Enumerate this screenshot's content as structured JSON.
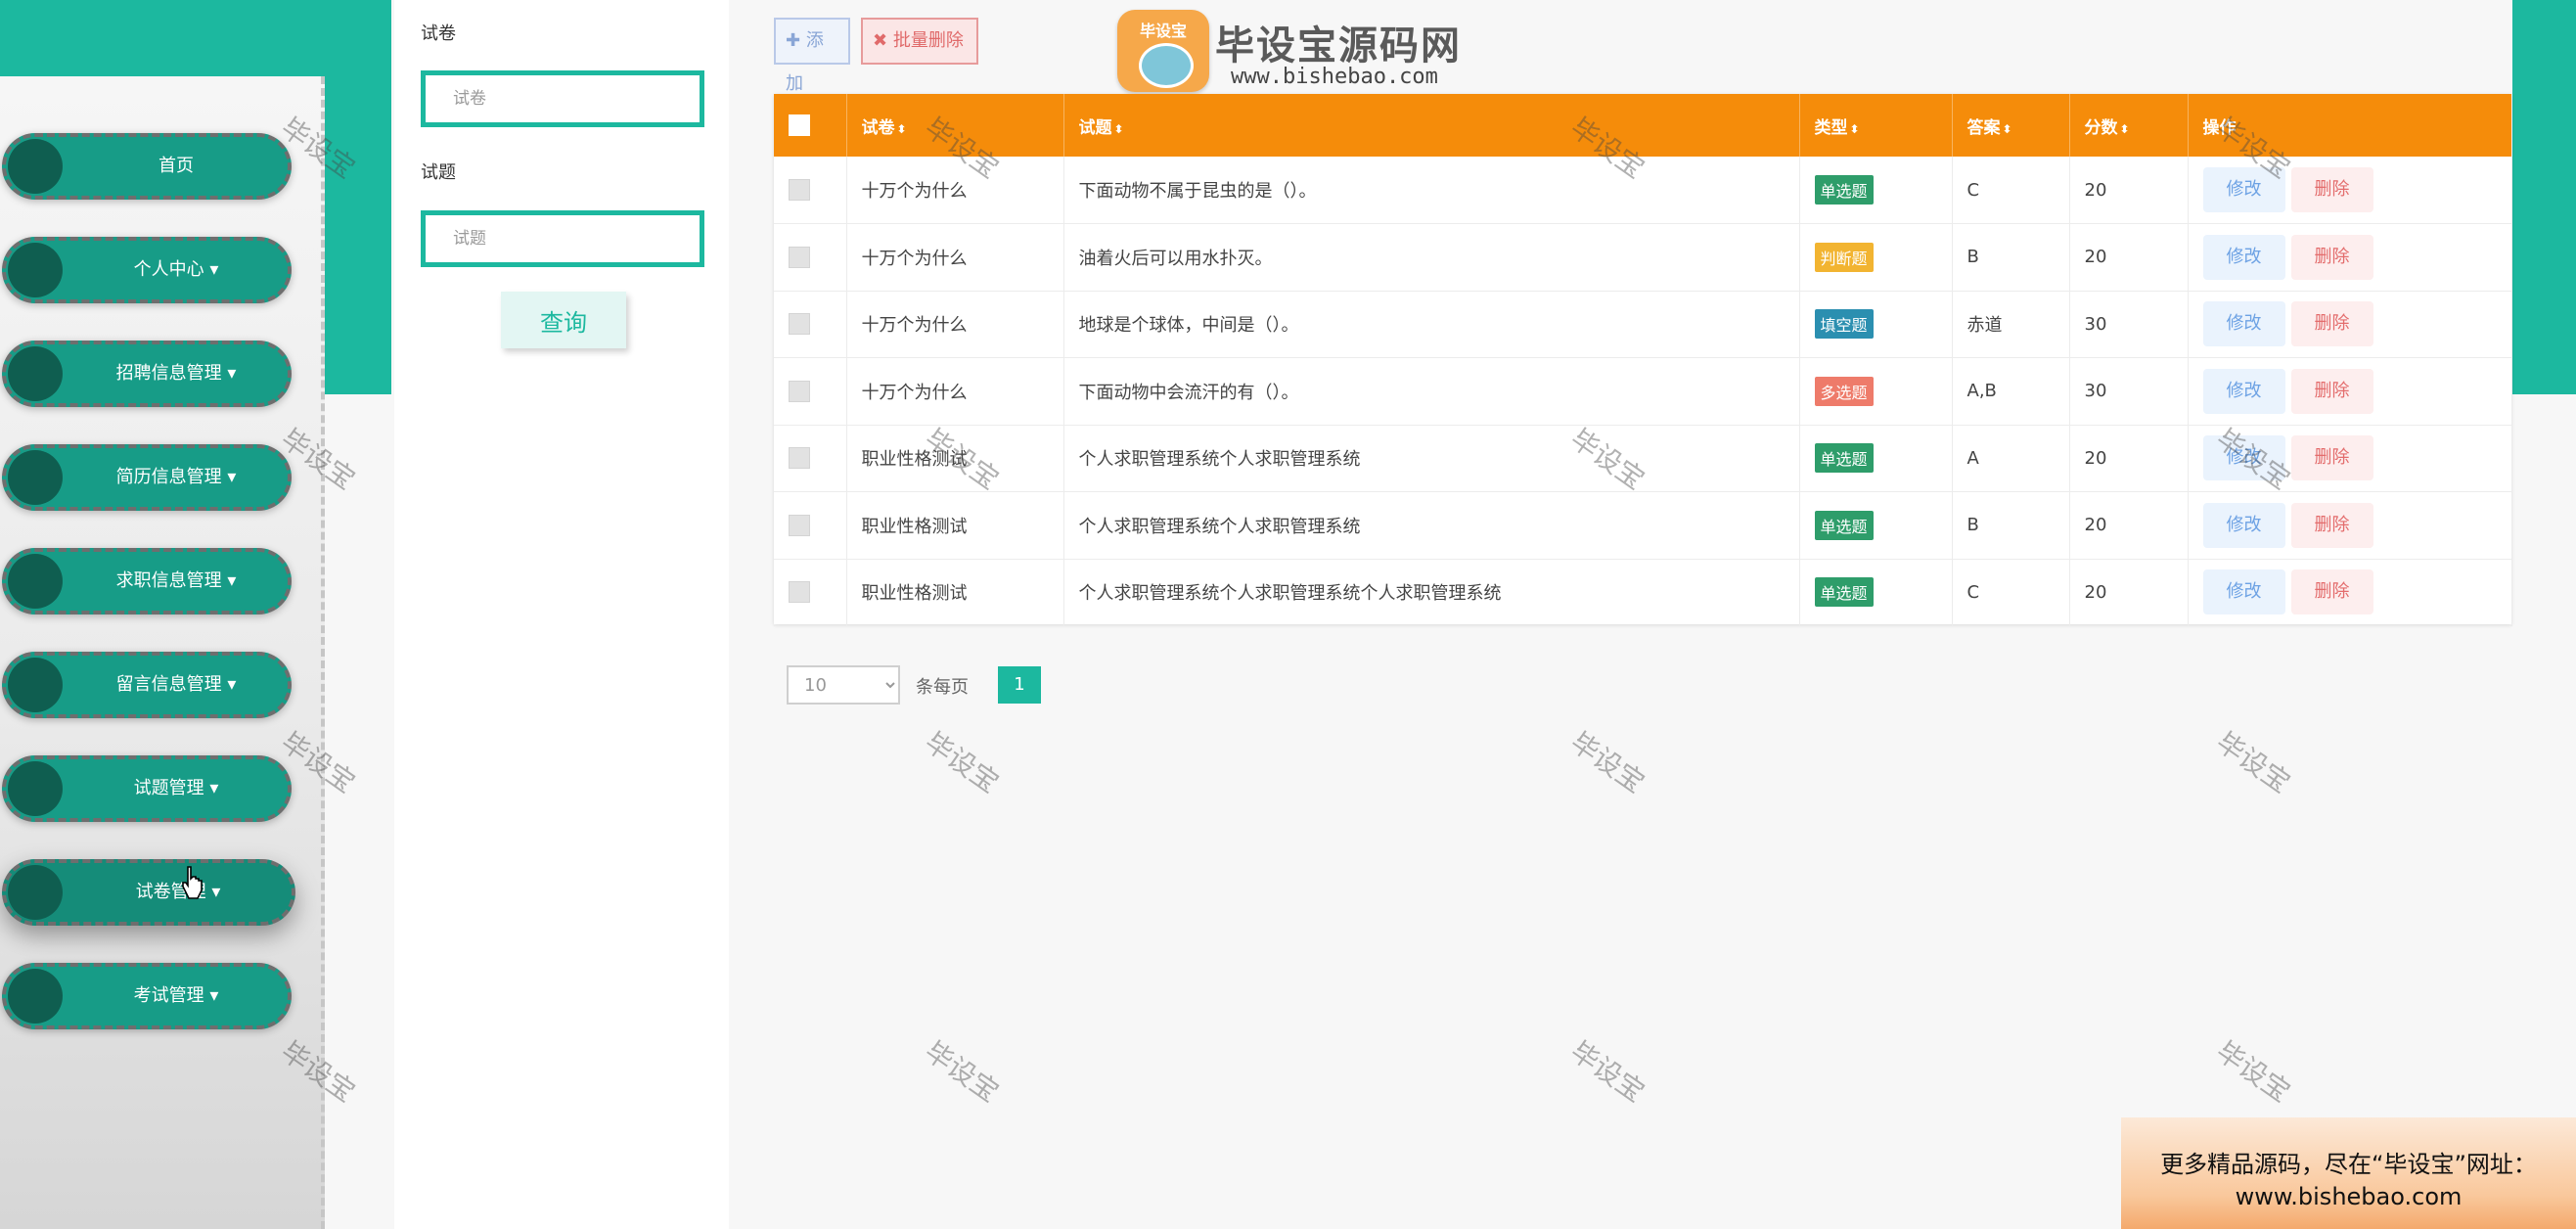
{
  "sidebar": {
    "items": [
      {
        "label": "首页",
        "has_dropdown": false
      },
      {
        "label": "个人中心",
        "has_dropdown": true
      },
      {
        "label": "招聘信息管理",
        "has_dropdown": true
      },
      {
        "label": "简历信息管理",
        "has_dropdown": true
      },
      {
        "label": "求职信息管理",
        "has_dropdown": true
      },
      {
        "label": "留言信息管理",
        "has_dropdown": true
      },
      {
        "label": "试题管理",
        "has_dropdown": true
      },
      {
        "label": "试卷管理",
        "has_dropdown": true,
        "active": true
      },
      {
        "label": "考试管理",
        "has_dropdown": true
      }
    ]
  },
  "search": {
    "paper_label": "试卷",
    "paper_placeholder": "试卷",
    "question_label": "试题",
    "question_placeholder": "试题",
    "query_button": "查询"
  },
  "toolbar": {
    "add_label": "添加",
    "batch_delete_label": "批量删除"
  },
  "logo": {
    "badge_text": "毕设宝",
    "title": "毕设宝源码网",
    "subtitle": "www.bishebao.com"
  },
  "table": {
    "headers": {
      "paper": "试卷",
      "question": "试题",
      "type": "类型",
      "answer": "答案",
      "score": "分数",
      "action": "操作"
    },
    "rows": [
      {
        "paper": "十万个为什么",
        "question": "下面动物不属于昆虫的是（）。",
        "type": "单选题",
        "type_color": "#2e9d6a",
        "answer": "C",
        "score": "20"
      },
      {
        "paper": "十万个为什么",
        "question": "油着火后可以用水扑灭。",
        "type": "判断题",
        "type_color": "#f2b431",
        "answer": "B",
        "score": "20"
      },
      {
        "paper": "十万个为什么",
        "question": "地球是个球体，中间是（）。",
        "type": "填空题",
        "type_color": "#2b8fb0",
        "answer": "赤道",
        "score": "30"
      },
      {
        "paper": "十万个为什么",
        "question": "下面动物中会流汗的有（）。",
        "type": "多选题",
        "type_color": "#ee7b6a",
        "answer": "A,B",
        "score": "30"
      },
      {
        "paper": "职业性格测试",
        "question": "个人求职管理系统个人求职管理系统",
        "type": "单选题",
        "type_color": "#2e9d6a",
        "answer": "A",
        "score": "20"
      },
      {
        "paper": "职业性格测试",
        "question": "个人求职管理系统个人求职管理系统",
        "type": "单选题",
        "type_color": "#2e9d6a",
        "answer": "B",
        "score": "20"
      },
      {
        "paper": "职业性格测试",
        "question": "个人求职管理系统个人求职管理系统个人求职管理系统",
        "type": "单选题",
        "type_color": "#2e9d6a",
        "answer": "C",
        "score": "20"
      }
    ],
    "edit_label": "修改",
    "delete_label": "删除"
  },
  "pagination": {
    "page_size": "10",
    "page_size_label": "条每页",
    "current_page": "1"
  },
  "watermark": "毕设宝",
  "promo": {
    "line1": "更多精品源码，尽在“毕设宝”网址：",
    "line2": "www.bishebao.com"
  },
  "colors": {
    "primary": "#1cb89f",
    "header": "#f58c0a",
    "menu": "#179c87"
  }
}
